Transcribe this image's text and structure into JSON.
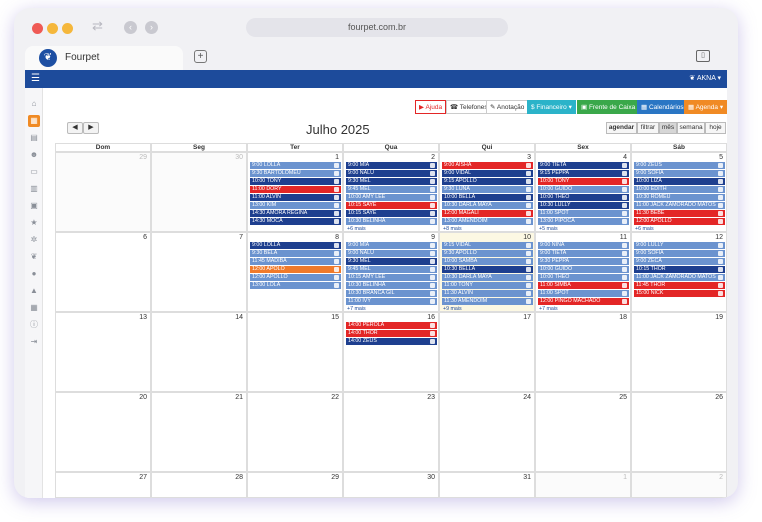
{
  "browser": {
    "url": "fourpet.com.br",
    "tab_title": "Fourpet",
    "back_icon": "arrow-left-icon",
    "forward_icon": "arrow-right-icon",
    "reload_icon": "reload-icon"
  },
  "app": {
    "user": "AKNA",
    "toolbar": {
      "ajuda": "Ajuda",
      "telefones": "Telefones",
      "anotacao": "Anotação",
      "financeiro": "Financeiro",
      "frente_caixa": "Frente de Caixa",
      "calendarios": "Calendários",
      "agenda": "Agenda"
    }
  },
  "calendar": {
    "title": "Julho 2025",
    "views": {
      "agendar": "agendar",
      "filtrar": "filtrar",
      "mes": "mês",
      "semana": "semana",
      "hoje": "hoje"
    },
    "weekdays": [
      "Dom",
      "Seg",
      "Ter",
      "Qua",
      "Qui",
      "Sex",
      "Sáb"
    ],
    "weeks": [
      [
        {
          "day": "29",
          "other": true,
          "events": []
        },
        {
          "day": "30",
          "other": true,
          "events": []
        },
        {
          "day": "1",
          "events": [
            {
              "t": "9:00 LOLLA",
              "c": "m"
            },
            {
              "t": "9:30 BARTOLOMEU",
              "c": "m"
            },
            {
              "t": "10:00 TONY",
              "c": "d"
            },
            {
              "t": "11:00 DORY",
              "c": "r"
            },
            {
              "t": "11:00 ALVIN",
              "c": "d"
            },
            {
              "t": "13:00 KIM",
              "c": "m"
            },
            {
              "t": "14:30 AMORA REGINA",
              "c": "d"
            },
            {
              "t": "14:30 MOCA",
              "c": "d"
            }
          ]
        },
        {
          "day": "2",
          "events": [
            {
              "t": "9:00 MIA",
              "c": "d"
            },
            {
              "t": "9:00 NALU",
              "c": "d"
            },
            {
              "t": "9:30 MEL",
              "c": "d"
            },
            {
              "t": "9:45 MEL",
              "c": "m"
            },
            {
              "t": "10:00 AMY LEE",
              "c": "m"
            },
            {
              "t": "10:15 SAYE",
              "c": "r"
            },
            {
              "t": "10:15 SAYE",
              "c": "d"
            },
            {
              "t": "10:30 BELINHA",
              "c": "m"
            }
          ],
          "more": "+6 mais"
        },
        {
          "day": "3",
          "events": [
            {
              "t": "9:00 AISHA",
              "c": "r"
            },
            {
              "t": "9:00 VIDAL",
              "c": "d"
            },
            {
              "t": "9:15 APOLLO",
              "c": "d"
            },
            {
              "t": "9:30 LUNA",
              "c": "m"
            },
            {
              "t": "10:00 BELLA",
              "c": "d"
            },
            {
              "t": "10:30 DARLA MAYA",
              "c": "m"
            },
            {
              "t": "12:00 MAGALI",
              "c": "r"
            },
            {
              "t": "13:00 AMENDOIM",
              "c": "m"
            }
          ],
          "more": "+8 mais"
        },
        {
          "day": "4",
          "events": [
            {
              "t": "9:00 TIETA",
              "c": "d"
            },
            {
              "t": "9:15 PEPPA",
              "c": "d"
            },
            {
              "t": "10:00 TONY",
              "c": "r"
            },
            {
              "t": "10:00 GUIDO",
              "c": "m"
            },
            {
              "t": "10:00 THEO",
              "c": "d"
            },
            {
              "t": "10:30 LULLY",
              "c": "d"
            },
            {
              "t": "11:00 SPOT",
              "c": "m"
            },
            {
              "t": "13:00 PIPOCA",
              "c": "m"
            }
          ],
          "more": "+5 mais"
        },
        {
          "day": "5",
          "events": [
            {
              "t": "9:00 ZEUS",
              "c": "m"
            },
            {
              "t": "9:00 SOFIA",
              "c": "m"
            },
            {
              "t": "10:00 LIZA",
              "c": "d"
            },
            {
              "t": "10:00 EDITH",
              "c": "m"
            },
            {
              "t": "10:30 ROMEU",
              "c": "m"
            },
            {
              "t": "11:00 JACK ZAMORADO MATOS",
              "c": "m"
            },
            {
              "t": "11:30 BEBE",
              "c": "r"
            },
            {
              "t": "12:00 APOLLO",
              "c": "r"
            }
          ],
          "more": "+6 mais"
        }
      ],
      [
        {
          "day": "6",
          "events": []
        },
        {
          "day": "7",
          "events": []
        },
        {
          "day": "8",
          "events": [
            {
              "t": "9:00 LOLLA",
              "c": "d"
            },
            {
              "t": "9:30 BELA",
              "c": "m"
            },
            {
              "t": "11:45 MADIBA",
              "c": "m"
            },
            {
              "t": "12:00 APOLO",
              "c": "o"
            },
            {
              "t": "12:00 APOLLO",
              "c": "m"
            },
            {
              "t": "13:00 LOLA",
              "c": "m"
            }
          ]
        },
        {
          "day": "9",
          "events": [
            {
              "t": "9:00 MIA",
              "c": "m"
            },
            {
              "t": "9:00 NALU",
              "c": "m"
            },
            {
              "t": "9:30 MEL",
              "c": "d"
            },
            {
              "t": "9:45 MEL",
              "c": "m"
            },
            {
              "t": "10:15 AMY LEE",
              "c": "m"
            },
            {
              "t": "10:30 BELINHA",
              "c": "m"
            },
            {
              "t": "10:30 BRANCA GIL",
              "c": "m"
            },
            {
              "t": "11:00 IVY",
              "c": "m"
            }
          ],
          "more": "+7 mais"
        },
        {
          "day": "10",
          "today": true,
          "events": [
            {
              "t": "9:15 VIDAL",
              "c": "m"
            },
            {
              "t": "9:30 APOLLO",
              "c": "m"
            },
            {
              "t": "10:00 SAMBA",
              "c": "m"
            },
            {
              "t": "10:30 BELLA",
              "c": "d"
            },
            {
              "t": "10:30 DARLA MAYA",
              "c": "m"
            },
            {
              "t": "11:00 TONY",
              "c": "m"
            },
            {
              "t": "11:30 ALVIN",
              "c": "m"
            },
            {
              "t": "11:30 AMENDOIM",
              "c": "m"
            }
          ],
          "more": "+9 mais"
        },
        {
          "day": "11",
          "events": [
            {
              "t": "9:00 NINA",
              "c": "m"
            },
            {
              "t": "9:00 TIETA",
              "c": "m"
            },
            {
              "t": "9:30 PEPPA",
              "c": "m"
            },
            {
              "t": "10:00 GUIDO",
              "c": "m"
            },
            {
              "t": "10:00 THEO",
              "c": "m"
            },
            {
              "t": "11:00 SIMBA",
              "c": "r"
            },
            {
              "t": "11:00 SPOT",
              "c": "m"
            },
            {
              "t": "12:00 PINGO MACHADO",
              "c": "r"
            }
          ],
          "more": "+7 mais"
        },
        {
          "day": "12",
          "events": [
            {
              "t": "9:00 LULLY",
              "c": "m"
            },
            {
              "t": "9:00 SOFIA",
              "c": "m"
            },
            {
              "t": "9:00 ZECA",
              "c": "m"
            },
            {
              "t": "10:15 THOR",
              "c": "d"
            },
            {
              "t": "11:00 JACK ZAMORADO MATOS",
              "c": "m"
            },
            {
              "t": "11:45 THOR",
              "c": "r"
            },
            {
              "t": "15:00 NICK",
              "c": "r"
            }
          ]
        }
      ],
      [
        {
          "day": "13",
          "events": []
        },
        {
          "day": "14",
          "events": []
        },
        {
          "day": "15",
          "events": []
        },
        {
          "day": "16",
          "events": [
            {
              "t": "14:00 PEROLA",
              "c": "r"
            },
            {
              "t": "14:00 THOR",
              "c": "r"
            },
            {
              "t": "14:00 ZEUS",
              "c": "d"
            }
          ]
        },
        {
          "day": "17",
          "events": []
        },
        {
          "day": "18",
          "events": []
        },
        {
          "day": "19",
          "events": []
        }
      ],
      [
        {
          "day": "20",
          "events": []
        },
        {
          "day": "21",
          "events": []
        },
        {
          "day": "22",
          "events": []
        },
        {
          "day": "23",
          "events": []
        },
        {
          "day": "24",
          "events": []
        },
        {
          "day": "25",
          "events": []
        },
        {
          "day": "26",
          "events": []
        }
      ],
      [
        {
          "day": "27",
          "events": []
        },
        {
          "day": "28",
          "events": []
        },
        {
          "day": "29",
          "events": []
        },
        {
          "day": "30",
          "events": []
        },
        {
          "day": "31",
          "events": []
        },
        {
          "day": "1",
          "other": true,
          "events": []
        },
        {
          "day": "2",
          "other": true,
          "events": []
        }
      ]
    ]
  },
  "colors": {
    "d": "#1e3f8f",
    "m": "#6b93cf",
    "r": "#e32626",
    "o": "#f07a2b"
  }
}
